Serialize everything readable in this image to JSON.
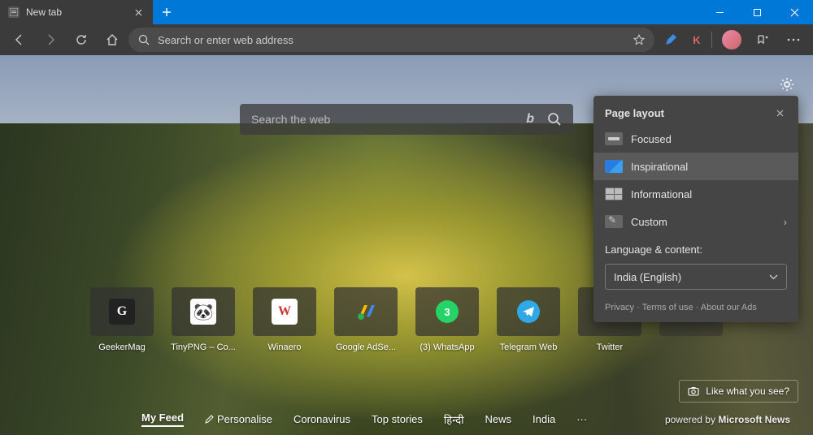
{
  "titlebar": {
    "tab_title": "New tab"
  },
  "toolbar": {
    "address_placeholder": "Search or enter web address",
    "profile_letter": "K"
  },
  "center_search": {
    "placeholder": "Search the web"
  },
  "tiles": [
    {
      "label": "GeekerMag",
      "bg": "#222",
      "fg": "#fff",
      "letter": "G"
    },
    {
      "label": "TinyPNG – Co...",
      "bg": "#fff",
      "fg": "#333",
      "emoji": "🐼"
    },
    {
      "label": "Winaero",
      "bg": "#fff",
      "fg": "#c33",
      "letter": "W"
    },
    {
      "label": "Google AdSe...",
      "bg": "transparent",
      "fg": "#fff",
      "adsense": true
    },
    {
      "label": "(3) WhatsApp",
      "bg": "#25d366",
      "fg": "#fff",
      "whatsapp": true,
      "badge": "3"
    },
    {
      "label": "Telegram Web",
      "bg": "#2fa8e8",
      "fg": "#fff",
      "telegram": true
    },
    {
      "label": "Twitter",
      "bg": "transparent",
      "fg": "#1da1f2",
      "twitter": true
    }
  ],
  "like_box": {
    "label": "Like what you see?"
  },
  "flyout": {
    "title": "Page layout",
    "items": [
      {
        "label": "Focused",
        "icon": "focused",
        "selected": false
      },
      {
        "label": "Inspirational",
        "icon": "insp",
        "selected": true
      },
      {
        "label": "Informational",
        "icon": "info",
        "selected": false
      },
      {
        "label": "Custom",
        "icon": "custom",
        "selected": false,
        "chevron": true
      }
    ],
    "section_label": "Language & content:",
    "select_value": "India (English)",
    "links": {
      "privacy": "Privacy",
      "terms": "Terms of use",
      "ads": "About our Ads"
    }
  },
  "feedbar": {
    "items": [
      "My Feed",
      "Personalise",
      "Coronavirus",
      "Top stories",
      "हिन्दी",
      "News",
      "India"
    ],
    "powered_prefix": "powered by ",
    "powered_brand": "Microsoft News"
  }
}
